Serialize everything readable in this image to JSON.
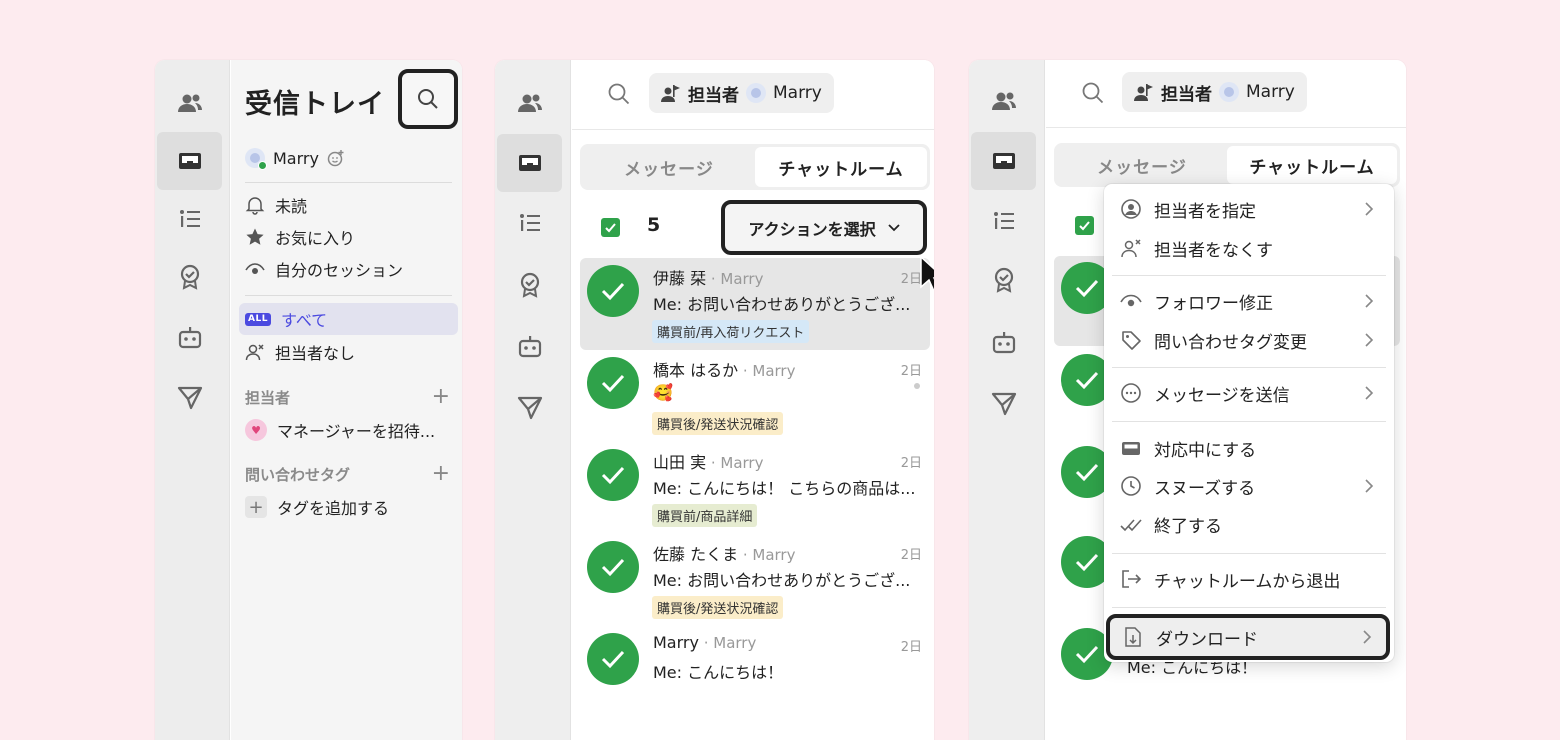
{
  "colors": {
    "background": "#fdebef",
    "accent_green": "#2fa24a",
    "selected_purple": "#4b4ae0",
    "tag_blue": "#d5e8f7",
    "tag_yellow": "#fbedc9",
    "tag_green": "#e6ecd1"
  },
  "rail": {
    "icons": [
      "contacts-icon",
      "inbox-icon",
      "list-icon",
      "badge-icon",
      "bot-icon",
      "send-icon"
    ],
    "active_index": 1
  },
  "panel1": {
    "title": "受信トレイ",
    "user": {
      "name": "Marry",
      "status_icon": "add-emoji-icon"
    },
    "filters": [
      {
        "label": "未読",
        "icon": "bell-icon"
      },
      {
        "label": "お気に入り",
        "icon": "star-icon"
      },
      {
        "label": "自分のセッション",
        "icon": "eye-icon"
      }
    ],
    "views": [
      {
        "label": "すべて",
        "badge": "ALL",
        "selected": true
      },
      {
        "label": "担当者なし",
        "icon": "unassigned-icon"
      }
    ],
    "assignee_heading": "担当者",
    "invite_manager": "マネージャーを招待...",
    "tags_heading": "問い合わせタグ",
    "add_tag": "タグを追加する"
  },
  "panel2": {
    "assignee_chip": {
      "label": "担当者",
      "value": "Marry"
    },
    "tabs": [
      "メッセージ",
      "チャットルーム"
    ],
    "active_tab": 1,
    "selected_count": "5",
    "action_button": "アクションを選択",
    "conversations": [
      {
        "name": "伊藤 栞",
        "by": "· Marry",
        "date": "2日",
        "message": "Me: お問い合わせありがとうござ...",
        "tag": "購買前/再入荷リクエスト",
        "tag_color": "blue",
        "selected": true
      },
      {
        "name": "橋本 はるか",
        "by": "· Marry",
        "date": "2日",
        "message": "🥰",
        "tag": "購買後/発送状況確認",
        "tag_color": "yellow",
        "unread": true
      },
      {
        "name": "山田 実",
        "by": "· Marry",
        "date": "2日",
        "message": "Me: こんにちは！ こちらの商品は...",
        "tag": "購買前/商品詳細",
        "tag_color": "green"
      },
      {
        "name": "佐藤 たくま",
        "by": "· Marry",
        "date": "2日",
        "message": "Me: お問い合わせありがとうござ...",
        "tag": "購買後/発送状況確認",
        "tag_color": "yellow"
      },
      {
        "name": "Marry",
        "by": "· Marry",
        "date": "2日",
        "message": "Me: こんにちは！",
        "tag": ""
      }
    ]
  },
  "panel3": {
    "assignee_chip": {
      "label": "担当者",
      "value": "Marry"
    },
    "tabs": [
      "メッセージ",
      "チャットルーム"
    ],
    "active_tab": 1,
    "background_preview_message": "Me: こんにちは！",
    "menu": {
      "groups": [
        [
          {
            "label": "担当者を指定",
            "icon": "person-circle-icon",
            "submenu": true
          },
          {
            "label": "担当者をなくす",
            "icon": "unassign-icon",
            "submenu": false
          }
        ],
        [
          {
            "label": "フォロワー修正",
            "icon": "eye-icon",
            "submenu": true
          },
          {
            "label": "問い合わせタグ変更",
            "icon": "tag-icon",
            "submenu": true
          }
        ],
        [
          {
            "label": "メッセージを送信",
            "icon": "chat-bubble-icon",
            "submenu": true
          }
        ],
        [
          {
            "label": "対応中にする",
            "icon": "inbox-tray-icon",
            "submenu": false
          },
          {
            "label": "スヌーズする",
            "icon": "clock-icon",
            "submenu": true
          },
          {
            "label": "終了する",
            "icon": "double-check-icon",
            "submenu": false
          }
        ],
        [
          {
            "label": "チャットルームから退出",
            "icon": "exit-icon",
            "submenu": false
          }
        ],
        [
          {
            "label": "ダウンロード",
            "icon": "download-file-icon",
            "submenu": true,
            "highlighted": true
          }
        ]
      ]
    }
  }
}
